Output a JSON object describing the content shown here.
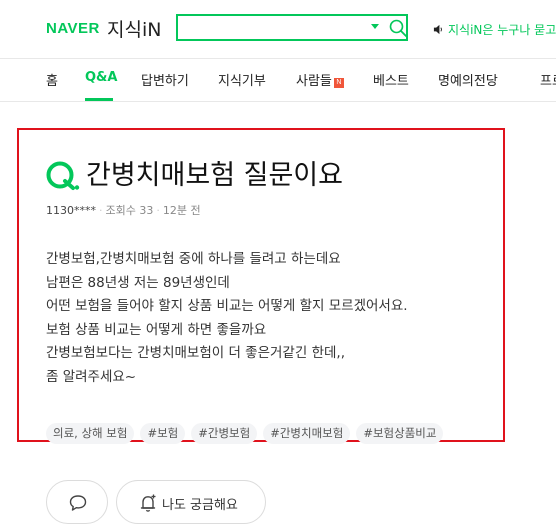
{
  "header": {
    "logo_naver": "NAVER",
    "logo_service": "지식iN",
    "search": {
      "value": "",
      "placeholder": ""
    },
    "notice": "지식iN은 누구나 묻고"
  },
  "nav": {
    "items": [
      {
        "label": "홈",
        "active": false
      },
      {
        "label": "Q&A",
        "active": true
      },
      {
        "label": "답변하기",
        "active": false
      },
      {
        "label": "지식기부",
        "active": false
      },
      {
        "label": "사람들",
        "active": false,
        "badge": "N"
      },
      {
        "label": "베스트",
        "active": false
      },
      {
        "label": "명예의전당",
        "active": false
      },
      {
        "label": "프로",
        "active": false
      }
    ]
  },
  "question": {
    "q_label": "Q.",
    "title": "간병치매보험 질문이요",
    "author": "1130****",
    "views": "조회수 33",
    "time": "12분 전",
    "body_lines": [
      "간병보험,간병치매보험 중에 하나를 들려고 하는데요",
      "남편은 88년생 저는 89년생인데",
      "어떤 보험을 들어야 할지 상품 비교는 어떻게 할지 모르겠어서요.",
      "보험 상품 비교는 어떻게 하면 좋을까요",
      "간병보험보다는 간병치매보험이 더 좋은거같긴 한데,,",
      "좀 알려주세요~"
    ],
    "tags": [
      "의료, 상해 보험",
      "#보험",
      "#간병보험",
      "#간병치매보험",
      "#보험상품비교"
    ]
  },
  "actions": {
    "curious_label": "나도 궁금해요"
  },
  "colors": {
    "brand_green": "#03c75a",
    "highlight_red": "#e0121c",
    "new_badge": "#f0563a"
  }
}
